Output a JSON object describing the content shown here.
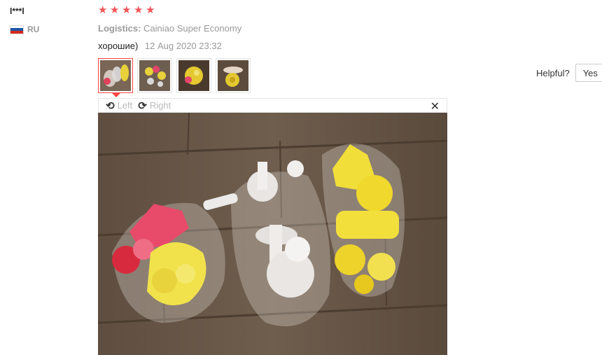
{
  "reviewer": {
    "name": "l***l",
    "country_code": "RU",
    "flag_colors": [
      "#ffffff",
      "#1c57a5",
      "#d52b1e"
    ]
  },
  "review": {
    "rating": 5,
    "star_color": "#f2555a",
    "logistics_label": "Logistics:",
    "logistics_value": "Cainiao Super Economy",
    "text": "хорошие)",
    "date": "12 Aug 2020 23:32"
  },
  "thumbnails": [
    {
      "name": "photo-1",
      "active": true
    },
    {
      "name": "photo-2",
      "active": false
    },
    {
      "name": "photo-3",
      "active": false
    },
    {
      "name": "photo-4",
      "active": false
    }
  ],
  "viewer": {
    "rotate_left_label": "Left",
    "rotate_right_label": "Right"
  },
  "helpful": {
    "label": "Helpful?",
    "yes_label": "Yes"
  }
}
